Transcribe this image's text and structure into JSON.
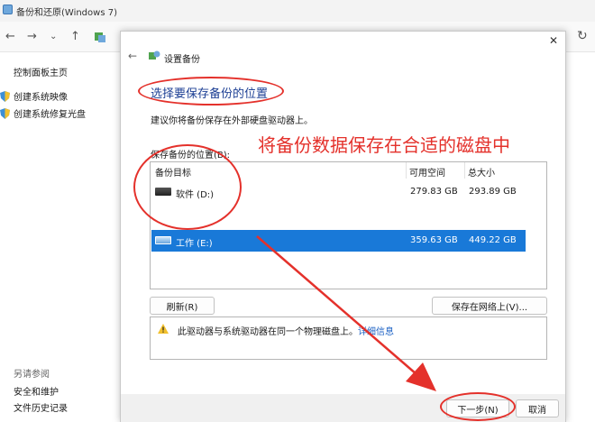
{
  "window": {
    "title": "备份和还原(Windows 7)"
  },
  "sidebar": {
    "home": "控制面板主页",
    "links": [
      "创建系统映像",
      "创建系统修复光盘"
    ],
    "see_also": "另请参阅",
    "bottom": [
      "安全和维护",
      "文件历史记录"
    ]
  },
  "dialog": {
    "title": "设置备份",
    "heading": "选择要保存备份的位置",
    "suggestion": "建议你将备份保存在外部硬盘驱动器上。",
    "location_label": "保存备份的位置(B):",
    "columns": [
      "备份目标",
      "可用空间",
      "总大小"
    ],
    "drives": [
      {
        "name": "软件 (D:)",
        "free": "279.83 GB",
        "total": "293.89 GB",
        "selected": false
      },
      {
        "name": "工作 (E:)",
        "free": "359.63 GB",
        "total": "449.22 GB",
        "selected": true
      }
    ],
    "refresh_label": "刷新(R)",
    "save_network_label": "保存在网络上(V)...",
    "warning_text": "此驱动器与系统驱动器在同一个物理磁盘上。",
    "warning_link": "详细信息",
    "next_label": "下一步(N)",
    "cancel_label": "取消"
  },
  "annotation": {
    "text": "将备份数据保存在合适的磁盘中",
    "color": "#e4312b"
  },
  "colors": {
    "selection": "#1979d8",
    "heading": "#1c3f94",
    "link": "#1c62c4"
  }
}
